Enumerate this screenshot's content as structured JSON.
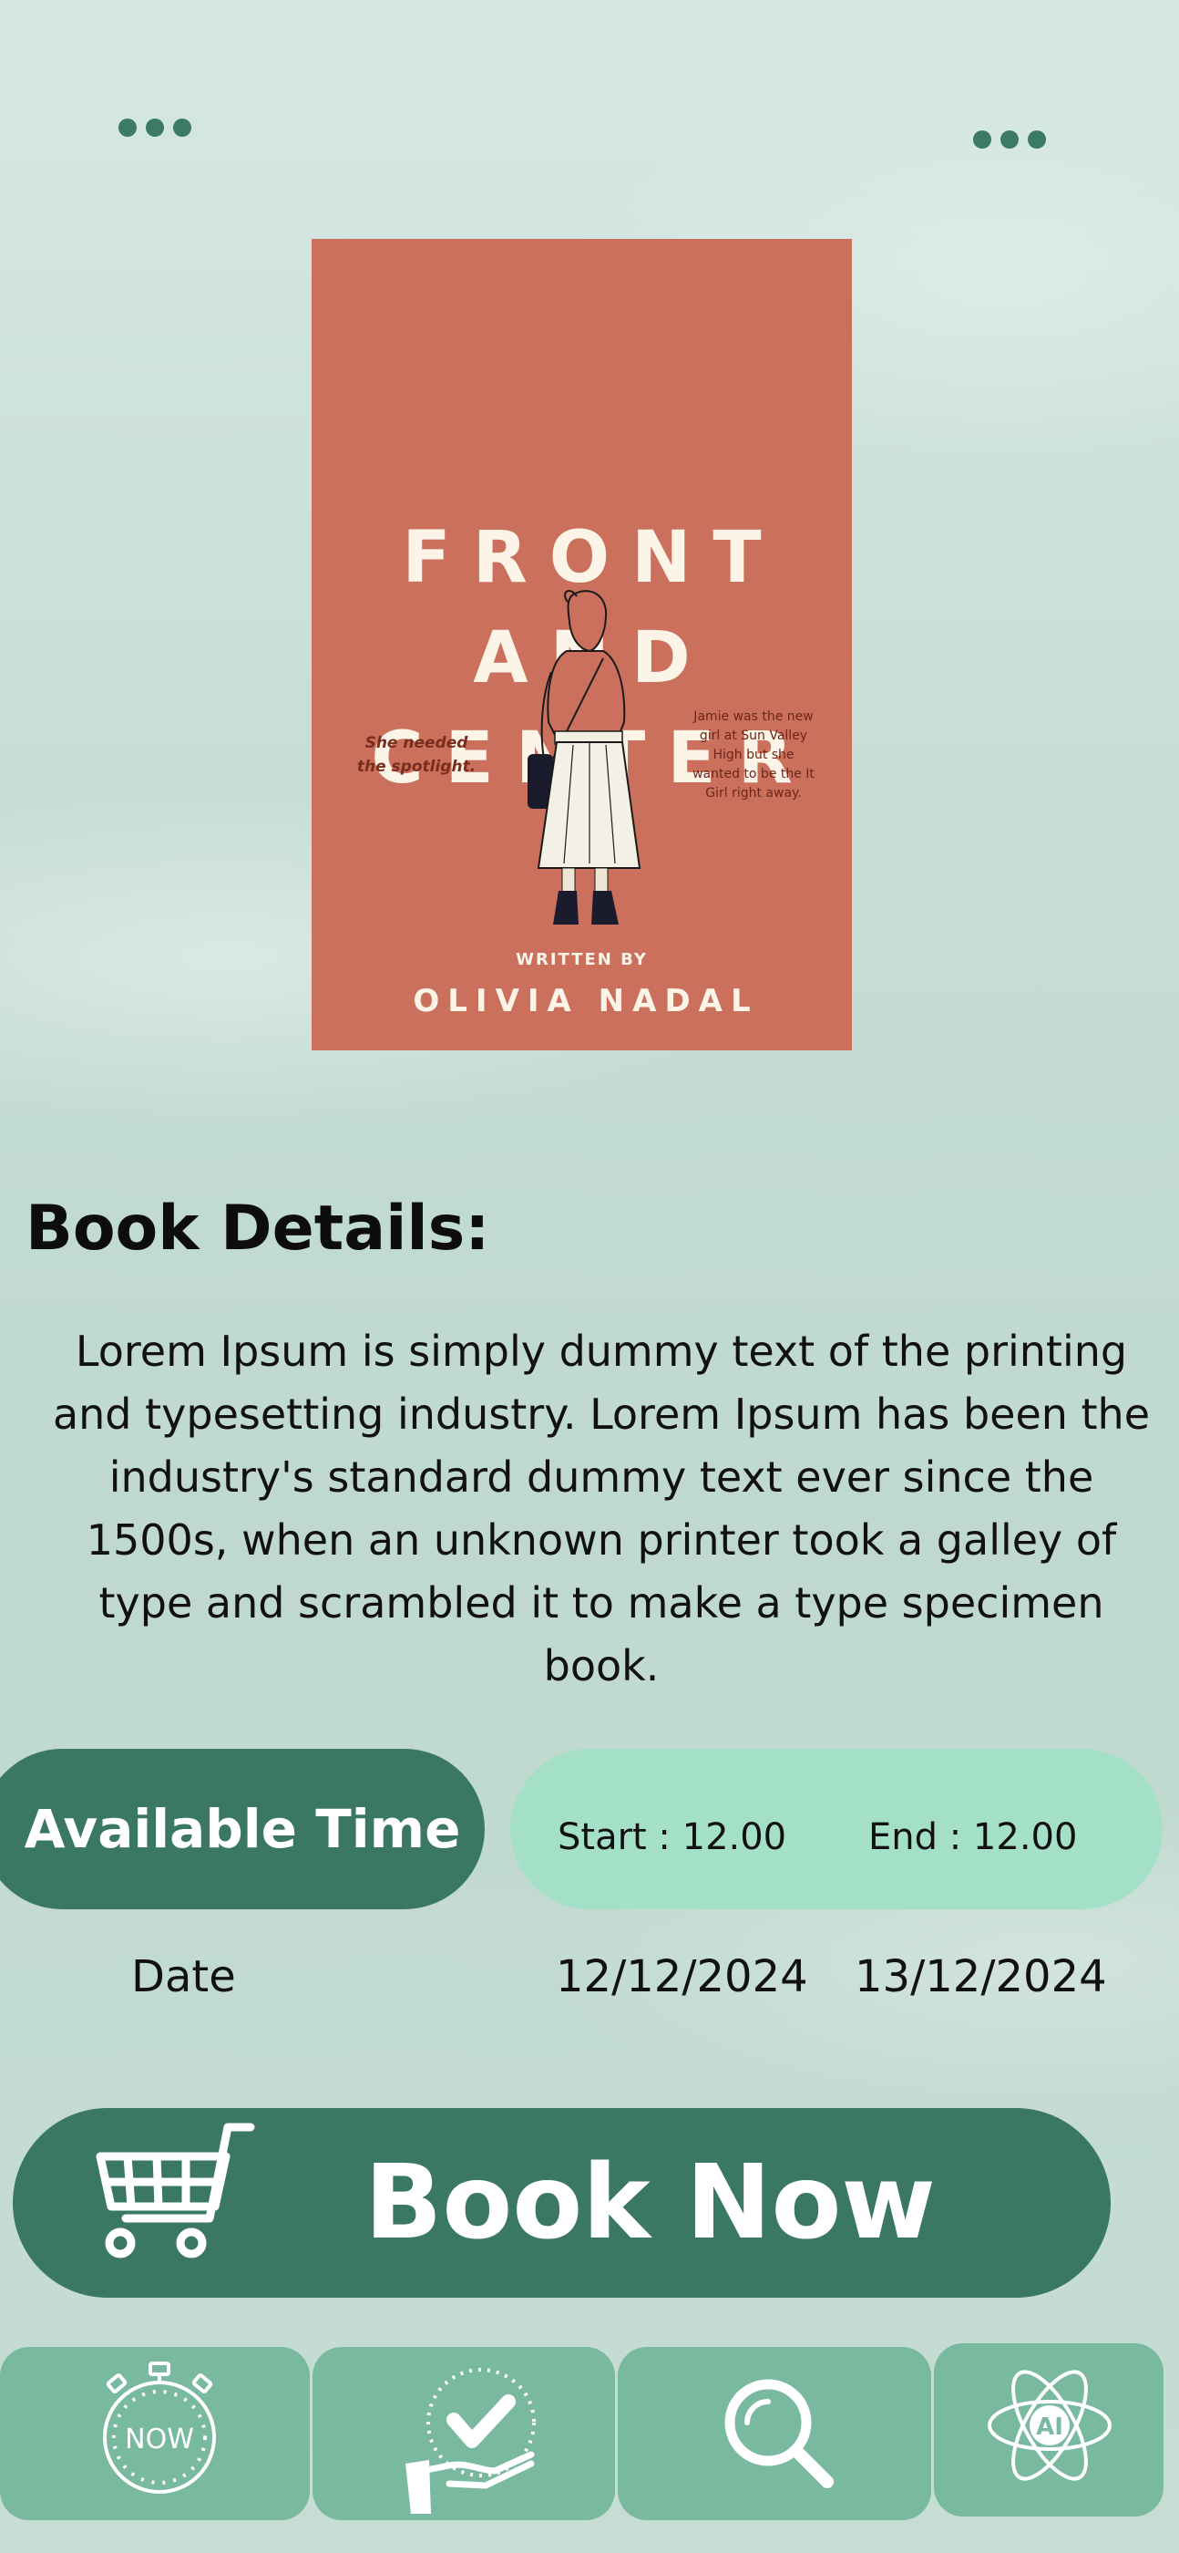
{
  "header": {
    "left_menu_icon": "more-horizontal-icon",
    "right_menu_icon": "more-horizontal-icon"
  },
  "cover": {
    "title_lines": [
      "FRONT",
      "AND",
      "CENTER"
    ],
    "tagline_left": [
      "She needed",
      "the spotlight."
    ],
    "blurb_right": [
      "Jamie was the new",
      "girl at Sun Valley",
      "High but she",
      "wanted to be the It",
      "Girl right away."
    ],
    "written_by": "WRITTEN BY",
    "author": "OLIVIA NADAL",
    "background_color": "#cb705d"
  },
  "details": {
    "heading": "Book Details:",
    "description": "Lorem Ipsum is simply dummy text of the printing and typesetting industry. Lorem Ipsum has been the industry's standard dummy text ever since the 1500s, when an unknown printer took a galley of type and scrambled it to make a type specimen book."
  },
  "availability": {
    "label": "Available Time",
    "start": "Start : 12.00",
    "end": "End : 12.00",
    "date_label": "Date",
    "start_date": "12/12/2024",
    "end_date": "13/12/2024"
  },
  "book_button": {
    "label": "Book Now",
    "icon": "shopping-cart-icon"
  },
  "bottom_nav": {
    "items": [
      {
        "name": "now",
        "icon": "stopwatch-now-icon",
        "text": "NOW"
      },
      {
        "name": "reserved",
        "icon": "hand-checkmark-icon"
      },
      {
        "name": "search",
        "icon": "search-icon"
      },
      {
        "name": "ai",
        "icon": "ai-atom-icon",
        "text": "AI"
      }
    ]
  },
  "colors": {
    "primary": "#3b7862",
    "mint": "#a4e0c8",
    "nav_tab": "#78b9a0",
    "cover": "#cb705d"
  }
}
